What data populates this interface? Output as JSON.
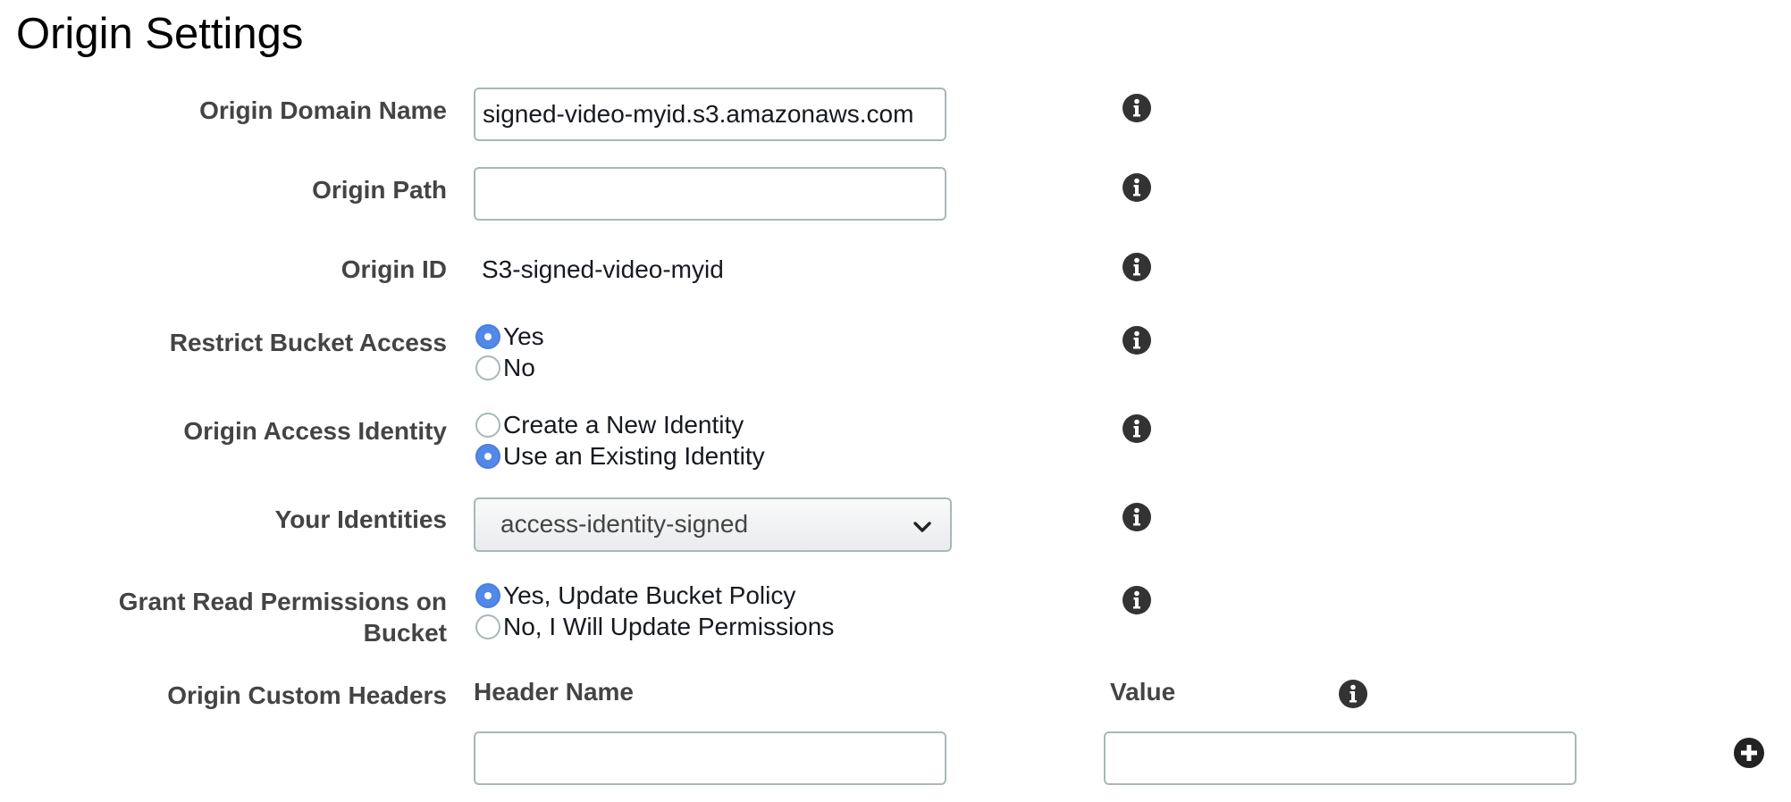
{
  "page_title": "Origin Settings",
  "icons": {
    "info": "info-circle-icon",
    "add": "plus-circle-icon",
    "dropdown": "chevron-down-icon"
  },
  "colors": {
    "radio_selected": "#5289e8",
    "label_text": "#444444",
    "icon": "#333333"
  },
  "fields": {
    "origin_domain_name": {
      "label": "Origin Domain Name",
      "value": "signed-video-myid.s3.amazonaws.com"
    },
    "origin_path": {
      "label": "Origin Path",
      "value": ""
    },
    "origin_id": {
      "label": "Origin ID",
      "value": "S3-signed-video-myid"
    },
    "restrict_bucket_access": {
      "label": "Restrict Bucket Access",
      "options": [
        {
          "label": "Yes",
          "selected": true
        },
        {
          "label": "No",
          "selected": false
        }
      ]
    },
    "origin_access_identity": {
      "label": "Origin Access Identity",
      "options": [
        {
          "label": "Create a New Identity",
          "selected": false
        },
        {
          "label": "Use an Existing Identity",
          "selected": true
        }
      ]
    },
    "your_identities": {
      "label": "Your Identities",
      "selected": "access-identity-signed"
    },
    "grant_read_permissions": {
      "label": "Grant Read Permissions on Bucket",
      "options": [
        {
          "label": "Yes, Update Bucket Policy",
          "selected": true
        },
        {
          "label": "No, I Will Update Permissions",
          "selected": false
        }
      ]
    },
    "origin_custom_headers": {
      "label": "Origin Custom Headers",
      "header_name_label": "Header Name",
      "value_label": "Value",
      "header_name_value": "",
      "value_value": ""
    }
  }
}
